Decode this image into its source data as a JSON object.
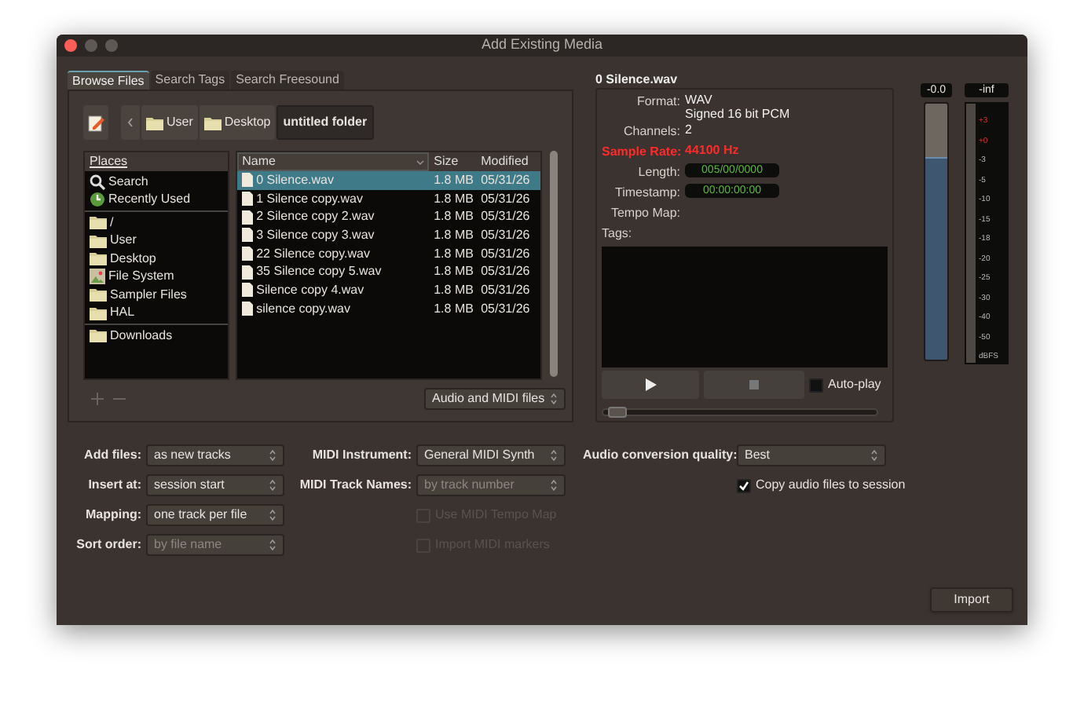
{
  "window": {
    "title": "Add Existing Media"
  },
  "tabs": [
    {
      "label": "Browse Files",
      "selected": true
    },
    {
      "label": "Search Tags",
      "selected": false
    },
    {
      "label": "Search Freesound",
      "selected": false
    }
  ],
  "path": [
    {
      "label": "User",
      "kind": "folder",
      "selected": false
    },
    {
      "label": "Desktop",
      "kind": "folder",
      "selected": false
    },
    {
      "label": "untitled folder",
      "kind": "plain",
      "selected": true
    }
  ],
  "places": {
    "header": "Places",
    "groups": [
      [
        {
          "label": "Search",
          "kind": "search"
        },
        {
          "label": "Recently Used",
          "kind": "recent"
        }
      ],
      [
        {
          "label": "/",
          "kind": "folder"
        },
        {
          "label": "User",
          "kind": "folder"
        },
        {
          "label": "Desktop",
          "kind": "folder"
        },
        {
          "label": "File System",
          "kind": "drive"
        },
        {
          "label": "Sampler Files",
          "kind": "folder"
        },
        {
          "label": "HAL",
          "kind": "folder"
        }
      ],
      [
        {
          "label": "Downloads",
          "kind": "folder"
        }
      ]
    ]
  },
  "files": {
    "columns": [
      "Name",
      "Size",
      "Modified"
    ],
    "rows": [
      {
        "name": "0 Silence.wav",
        "size": "1.8 MB",
        "modified": "05/31/26",
        "selected": true
      },
      {
        "name": "1 Silence copy.wav",
        "size": "1.8 MB",
        "modified": "05/31/26",
        "selected": false
      },
      {
        "name": "2 Silence copy 2.wav",
        "size": "1.8 MB",
        "modified": "05/31/26",
        "selected": false
      },
      {
        "name": "3 Silence copy 3.wav",
        "size": "1.8 MB",
        "modified": "05/31/26",
        "selected": false
      },
      {
        "name": "22 Silence copy.wav",
        "size": "1.8 MB",
        "modified": "05/31/26",
        "selected": false
      },
      {
        "name": "35 Silence copy 5.wav",
        "size": "1.8 MB",
        "modified": "05/31/26",
        "selected": false
      },
      {
        "name": "Silence copy 4.wav",
        "size": "1.8 MB",
        "modified": "05/31/26",
        "selected": false
      },
      {
        "name": "silence copy.wav",
        "size": "1.8 MB",
        "modified": "05/31/26",
        "selected": false
      }
    ],
    "filter": "Audio and MIDI files"
  },
  "info": {
    "title": "0 Silence.wav",
    "fields": [
      {
        "label": "Format:",
        "value": "WAV\nSigned 16 bit PCM",
        "kind": "text",
        "alert": false
      },
      {
        "label": "Channels:",
        "value": "2",
        "kind": "text",
        "alert": false
      },
      {
        "label": "Sample Rate:",
        "value": "44100 Hz",
        "kind": "text",
        "alert": true
      },
      {
        "label": "Length:",
        "value": "005/00/0000",
        "kind": "timecode",
        "alert": false
      },
      {
        "label": "Timestamp:",
        "value": "00:00:00:00",
        "kind": "timecode",
        "alert": false
      },
      {
        "label": "Tempo Map:",
        "alert": false
      }
    ],
    "tags_label": "Tags:",
    "auto_play": {
      "label": "Auto-play",
      "checked": false
    },
    "seek": {
      "level": 0.02
    }
  },
  "fader": {
    "reading": "-0.0",
    "level": 0.79
  },
  "meter": {
    "reading": "-inf",
    "scale": [
      {
        "label": "+3",
        "hot": true
      },
      {
        "label": "+0",
        "hot": true
      },
      {
        "label": "-3",
        "hot": false
      },
      {
        "label": "-5",
        "hot": false
      },
      {
        "label": "-10",
        "hot": false
      },
      {
        "label": "-15",
        "hot": false
      },
      {
        "label": "-18",
        "hot": false
      },
      {
        "label": "-20",
        "hot": false
      },
      {
        "label": "-25",
        "hot": false
      },
      {
        "label": "-30",
        "hot": false
      },
      {
        "label": "-40",
        "hot": false
      },
      {
        "label": "-50",
        "hot": false
      },
      {
        "label": "dBFS",
        "hot": false
      }
    ]
  },
  "options": [
    [
      {
        "kind": "select",
        "label": "Add files:",
        "value": "as new tracks",
        "disabled": false
      },
      {
        "kind": "select",
        "label": "Insert at:",
        "value": "session start",
        "disabled": false
      },
      {
        "kind": "select",
        "label": "Mapping:",
        "value": "one track per file",
        "disabled": false
      },
      {
        "kind": "select",
        "label": "Sort order:",
        "value": "by file name",
        "disabled": true
      }
    ],
    [
      {
        "kind": "select",
        "label": "MIDI Instrument:",
        "value": "General MIDI Synth",
        "disabled": false
      },
      {
        "kind": "select",
        "label": "MIDI Track Names:",
        "value": "by track number",
        "disabled": true
      },
      {
        "kind": "checkbox",
        "label": "Use MIDI Tempo Map",
        "checked": false,
        "disabled": true
      },
      {
        "kind": "checkbox",
        "label": "Import MIDI markers",
        "checked": false,
        "disabled": true
      }
    ],
    [
      {
        "kind": "select",
        "label": "Audio conversion quality:",
        "value": "Best",
        "disabled": false
      },
      {
        "kind": "checkbox",
        "label": "Copy audio files to session",
        "checked": true,
        "disabled": false
      }
    ]
  ],
  "import_button": "Import"
}
